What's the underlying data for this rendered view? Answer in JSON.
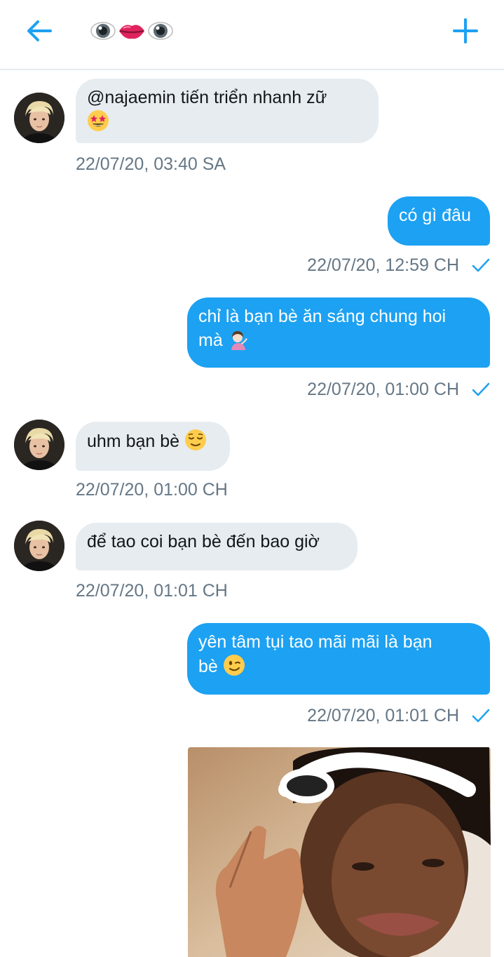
{
  "header": {
    "back_icon": "arrow-left-icon",
    "title_emojis": [
      "eye",
      "lips",
      "eye"
    ],
    "new_icon": "plus-icon",
    "accent": "#1da1f2"
  },
  "messages": [
    {
      "side": "in",
      "text": "@najaemin tiến triển nhanh zữ",
      "emoji": "star-struck",
      "time": "22/07/20, 03:40 SA"
    },
    {
      "side": "out",
      "text": "có gì đâu",
      "time": "22/07/20, 12:59 CH"
    },
    {
      "side": "out",
      "text": "chỉ là bạn bè ăn sáng chung hoi",
      "text2": "mà",
      "emoji": "woman-tipping-hand",
      "time": "22/07/20, 01:00 CH"
    },
    {
      "side": "in",
      "text": "uhm bạn bè",
      "emoji": "relieved-face",
      "time": "22/07/20, 01:00 CH"
    },
    {
      "side": "in",
      "text": "để tao coi bạn bè đến bao giờ",
      "time": "22/07/20, 01:01 CH"
    },
    {
      "side": "out",
      "text": "yên tâm tụi tao mãi mãi là bạn",
      "text2": "bè",
      "emoji": "winking-face",
      "time": "22/07/20, 01:01 CH"
    }
  ],
  "colors": {
    "incoming_bubble": "#e6ecf0",
    "outgoing_bubble": "#1da1f2",
    "timestamp": "#657786"
  }
}
